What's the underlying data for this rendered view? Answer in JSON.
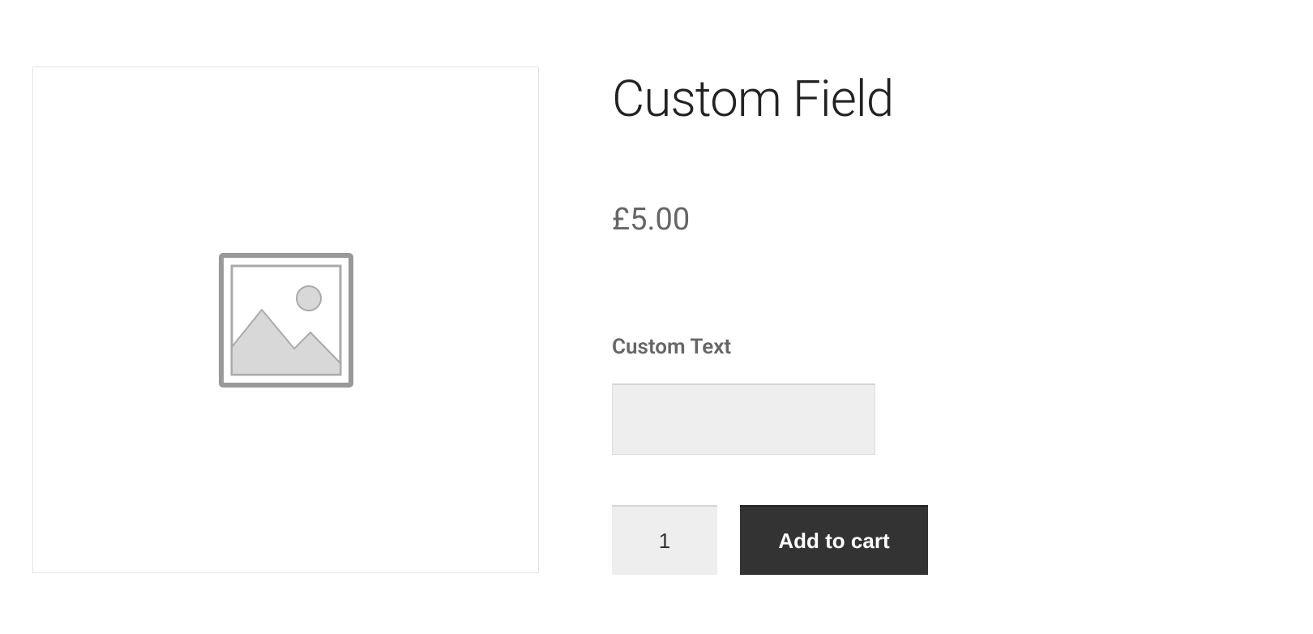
{
  "product": {
    "title": "Custom Field",
    "price": "£5.00",
    "custom_field": {
      "label": "Custom Text",
      "value": ""
    },
    "quantity": "1",
    "add_to_cart_label": "Add to cart"
  }
}
